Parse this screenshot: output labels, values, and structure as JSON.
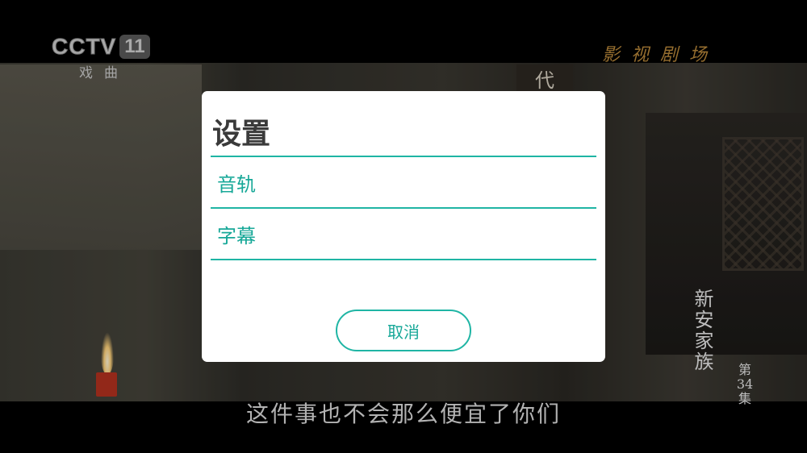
{
  "broadcast": {
    "logo": "CCTV",
    "channel_number": "11",
    "channel_sub": "戏曲",
    "program": "影视剧场",
    "drama_title": "新安家族",
    "episode_prefix": "第",
    "episode_number": "34",
    "episode_suffix": "集",
    "subtitle": "这件事也不会那么便宜了你们",
    "plaque": "代"
  },
  "dialog": {
    "title": "设置",
    "items": [
      {
        "label": "音轨"
      },
      {
        "label": "字幕"
      }
    ],
    "cancel_label": "取消"
  },
  "colors": {
    "accent": "#1fb5a4",
    "accent_text": "#17a898",
    "dialog_bg": "#ffffff",
    "title_text": "#3a3a3a"
  }
}
